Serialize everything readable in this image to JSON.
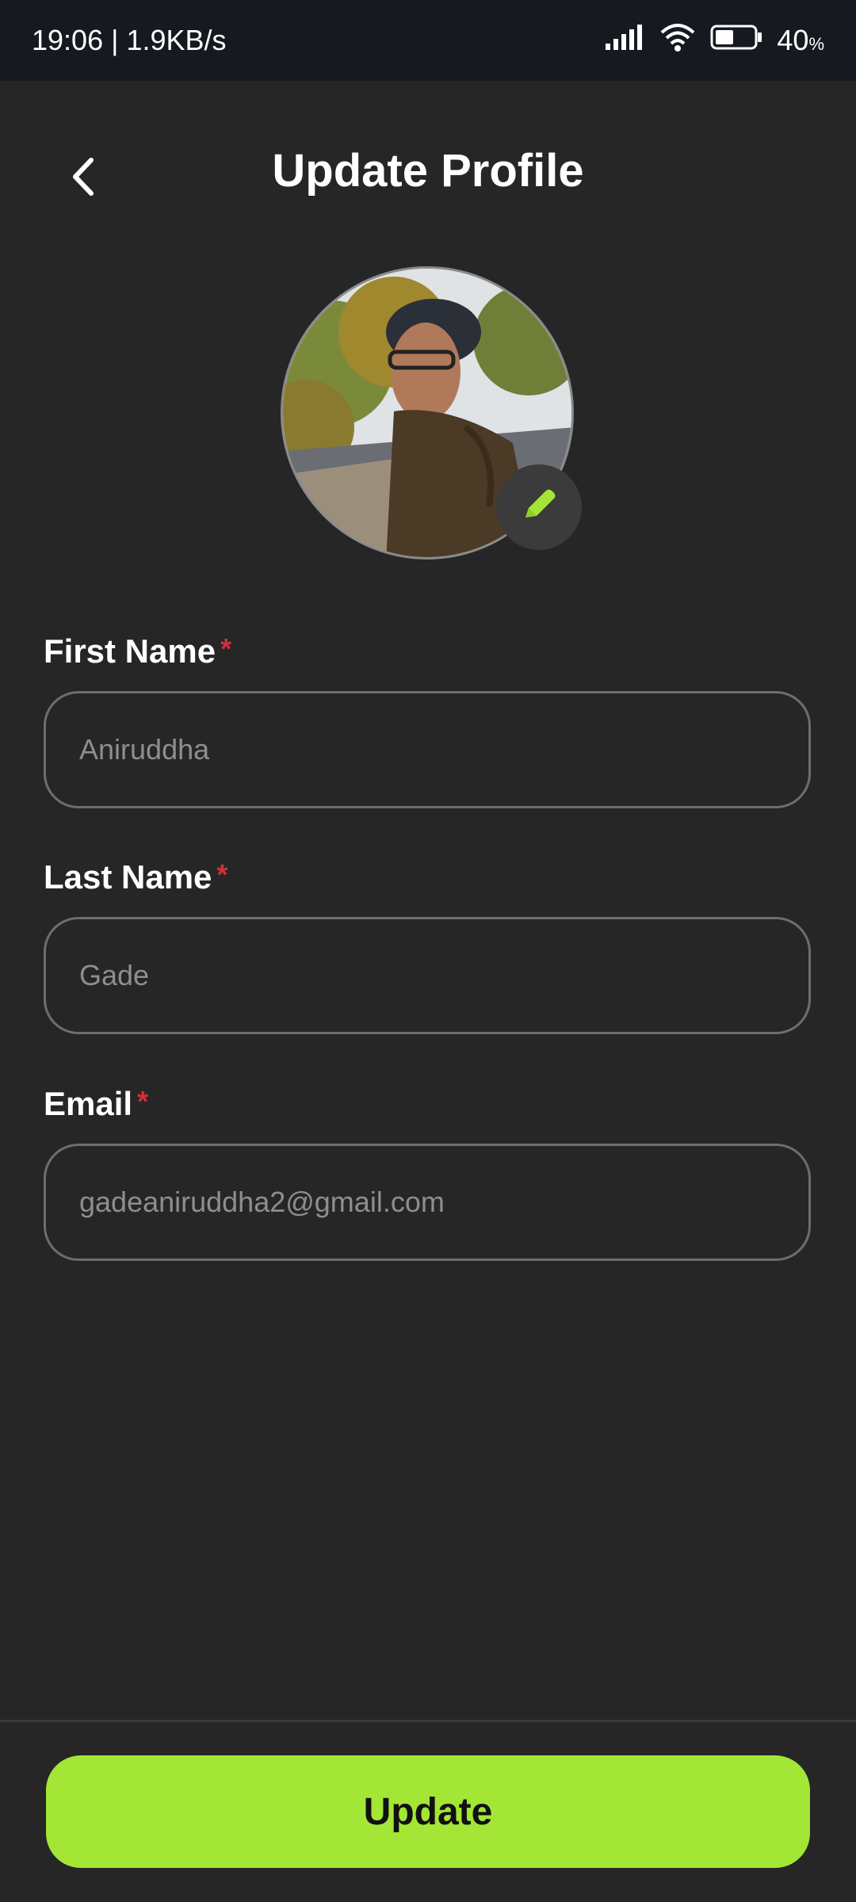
{
  "status_bar": {
    "time_speed": "19:06 | 1.9KB/s",
    "battery_percent": "40",
    "battery_unit": "%",
    "icons": [
      "signal-icon",
      "wifi-icon",
      "battery-icon"
    ]
  },
  "header": {
    "title": "Update Profile",
    "back_icon": "chevron-left-icon"
  },
  "profile": {
    "edit_icon": "pencil-icon",
    "accent_color": "#a3e635"
  },
  "form": {
    "required_marker": "*",
    "first_name": {
      "label": "First Name",
      "value": "Aniruddha"
    },
    "last_name": {
      "label": "Last Name",
      "value": "Gade"
    },
    "email": {
      "label": "Email",
      "value": "gadeaniruddha2@gmail.com"
    }
  },
  "footer": {
    "update_label": "Update"
  },
  "colors": {
    "background": "#262626",
    "status_bar": "#161a20",
    "accent": "#a3e635",
    "required": "#d32f3a"
  }
}
